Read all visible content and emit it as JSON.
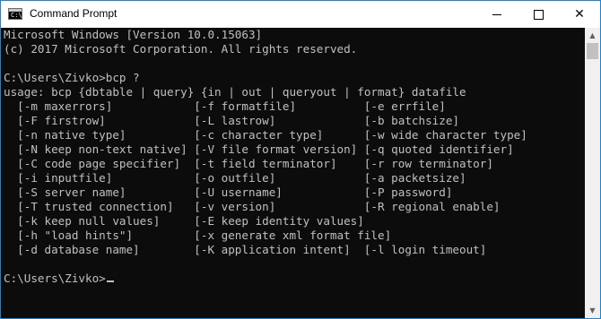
{
  "window": {
    "title": "Command Prompt",
    "icon": "cmd-icon",
    "minimize_icon": "minimize-icon",
    "maximize_icon": "maximize-icon",
    "close_icon": "close-icon",
    "close_glyph": "✕"
  },
  "console": {
    "lines": [
      "Microsoft Windows [Version 10.0.15063]",
      "(c) 2017 Microsoft Corporation. All rights reserved.",
      "",
      "C:\\Users\\Zivko>bcp ?",
      "usage: bcp {dbtable | query} {in | out | queryout | format} datafile",
      "  [-m maxerrors]            [-f formatfile]          [-e errfile]",
      "  [-F firstrow]             [-L lastrow]             [-b batchsize]",
      "  [-n native type]          [-c character type]      [-w wide character type]",
      "  [-N keep non-text native] [-V file format version] [-q quoted identifier]",
      "  [-C code page specifier]  [-t field terminator]    [-r row terminator]",
      "  [-i inputfile]            [-o outfile]             [-a packetsize]",
      "  [-S server name]          [-U username]            [-P password]",
      "  [-T trusted connection]   [-v version]             [-R regional enable]",
      "  [-k keep null values]     [-E keep identity values]",
      "  [-h \"load hints\"]         [-x generate xml format file]",
      "  [-d database name]        [-K application intent]  [-l login timeout]",
      "",
      "C:\\Users\\Zivko>"
    ]
  },
  "scrollbar": {
    "up_arrow": "▲",
    "down_arrow": "▼"
  }
}
